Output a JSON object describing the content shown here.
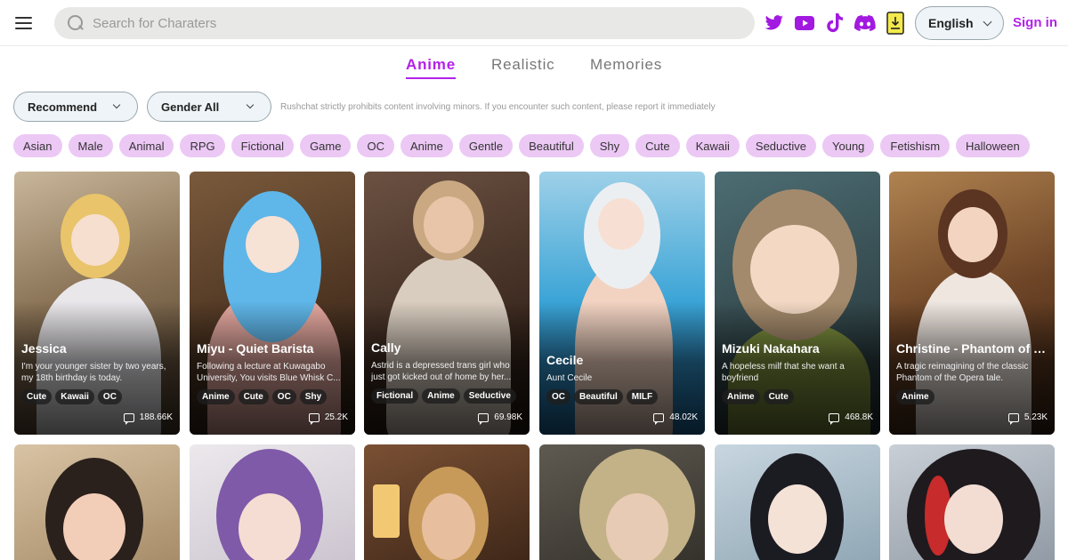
{
  "search": {
    "placeholder": "Search for Charaters"
  },
  "header": {
    "language": "English",
    "sign_in": "Sign in"
  },
  "social_icons": [
    "twitter-icon",
    "youtube-icon",
    "tiktok-icon",
    "discord-icon",
    "download-app-icon"
  ],
  "colors": {
    "accent": "#b321e8",
    "tag_bg": "#ecc8f5",
    "social": "#a219e0"
  },
  "tabs": [
    {
      "label": "Anime",
      "active": true
    },
    {
      "label": "Realistic",
      "active": false
    },
    {
      "label": "Memories",
      "active": false
    }
  ],
  "filters": {
    "sort": "Recommend",
    "gender": "Gender All",
    "notice": "Rushchat strictly prohibits content involving minors. If you encounter such content, please report it immediately"
  },
  "tags": [
    "Asian",
    "Male",
    "Animal",
    "RPG",
    "Fictional",
    "Game",
    "OC",
    "Anime",
    "Gentle",
    "Beautiful",
    "Shy",
    "Cute",
    "Kawaii",
    "Seductive",
    "Young",
    "Fetishism",
    "Halloween"
  ],
  "cards": [
    {
      "name": "Jessica",
      "desc": "I'm your younger sister by two years, my 18th birthday is today.",
      "tags": [
        "Cute",
        "Kawaii",
        "OC"
      ],
      "count": "188.66K"
    },
    {
      "name": "Miyu - Quiet Barista",
      "desc": "Following a lecture at Kuwagabo University, You visits Blue Whisk C...",
      "tags": [
        "Anime",
        "Cute",
        "OC",
        "Shy"
      ],
      "count": "25.2K"
    },
    {
      "name": "Cally",
      "desc": "Astrid is a depressed trans girl who just got kicked out of home by her...",
      "tags": [
        "Fictional",
        "Anime",
        "Seductive"
      ],
      "count": "69.98K"
    },
    {
      "name": "Cecile",
      "desc": "Aunt Cecile",
      "tags": [
        "OC",
        "Beautiful",
        "MILF"
      ],
      "count": "48.02K"
    },
    {
      "name": "Mizuki Nakahara",
      "desc": "A hopeless milf that she want a boyfriend",
      "tags": [
        "Anime",
        "Cute"
      ],
      "count": "468.8K"
    },
    {
      "name": "Christine - Phantom of the Opera",
      "desc": "A tragic reimagining of the classic Phantom of the Opera tale.",
      "tags": [
        "Anime"
      ],
      "count": "5.23K"
    }
  ]
}
